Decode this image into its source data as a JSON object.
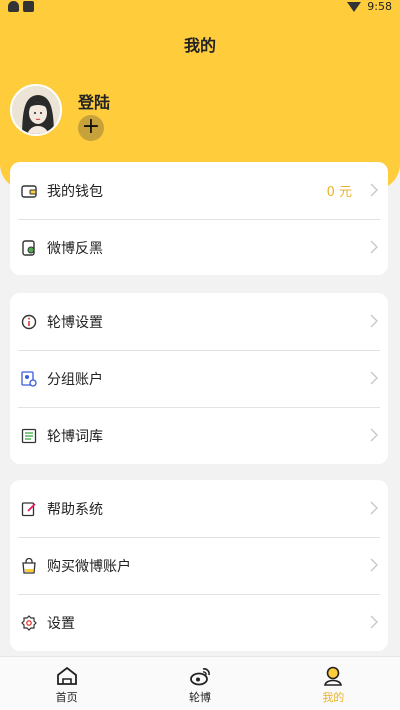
{
  "status_bar": {
    "time": "9:58"
  },
  "header": {
    "title": "我的",
    "login_label": "登陆",
    "add_symbol": "+"
  },
  "wallet_card": {
    "items": [
      {
        "label": "我的钱包",
        "value": "0 元",
        "icon": "wallet-icon"
      },
      {
        "label": "微博反黑",
        "icon": "shield-icon"
      }
    ]
  },
  "tools_card": {
    "items": [
      {
        "label": "轮博设置",
        "icon": "info-icon"
      },
      {
        "label": "分组账户",
        "icon": "user-group-icon"
      },
      {
        "label": "轮博词库",
        "icon": "word-list-icon"
      }
    ]
  },
  "more_card": {
    "items": [
      {
        "label": "帮助系统",
        "icon": "edit-note-icon"
      },
      {
        "label": "购买微博账户",
        "icon": "shopping-bag-icon"
      },
      {
        "label": "设置",
        "icon": "gear-icon"
      }
    ]
  },
  "tabbar": {
    "tabs": [
      {
        "label": "首页",
        "icon": "home-icon"
      },
      {
        "label": "轮博",
        "icon": "weibo-icon"
      },
      {
        "label": "我的",
        "icon": "profile-icon",
        "active": true
      }
    ]
  },
  "colors": {
    "accent": "#ffcd3c",
    "accent_text": "#e9b42a",
    "background": "#f2f2f2"
  }
}
